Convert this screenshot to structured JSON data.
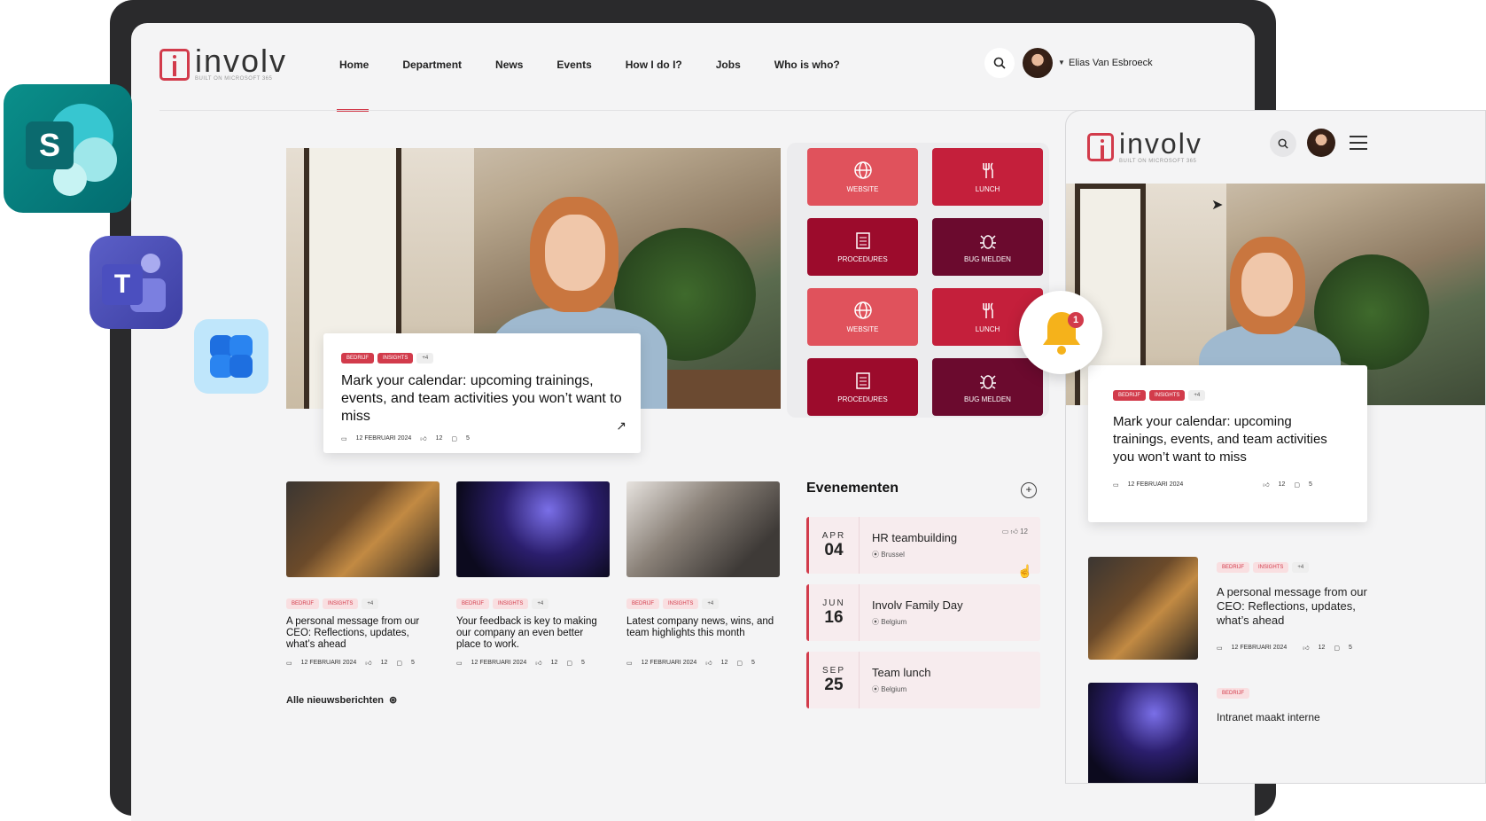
{
  "brand": {
    "name": "involv",
    "sub": "BUILT ON MICROSOFT 365",
    "accent": "#d23b4b"
  },
  "nav": {
    "items": [
      "Home",
      "Department",
      "News",
      "Events",
      "How I do I?",
      "Jobs",
      "Who is who?"
    ],
    "user": "Elias Van Esbroeck"
  },
  "hero": {
    "tags": [
      "BEDRIJF",
      "INSIGHTS",
      "+4"
    ],
    "title": "Mark your calendar: upcoming trainings, events, and team activities you won’t want to miss",
    "date": "12 FEBRUARI 2024",
    "likes": "12",
    "comments": "5"
  },
  "tiles": [
    {
      "label": "WEBSITE",
      "icon": "globe-icon"
    },
    {
      "label": "LUNCH",
      "icon": "cutlery-icon"
    },
    {
      "label": "PROCEDURES",
      "icon": "document-icon"
    },
    {
      "label": "BUG MELDEN",
      "icon": "bug-icon"
    },
    {
      "label": "WEBSITE",
      "icon": "globe-icon"
    },
    {
      "label": "LUNCH",
      "icon": "cutlery-icon"
    },
    {
      "label": "PROCEDURES",
      "icon": "document-icon"
    },
    {
      "label": "BUG MELDEN",
      "icon": "bug-icon"
    }
  ],
  "notification": {
    "count": "1"
  },
  "news": [
    {
      "tags": [
        "BEDRIJF",
        "INSIGHTS",
        "+4"
      ],
      "title": "A personal message from our CEO: Reflections, updates, what’s ahead",
      "date": "12 FEBRUARI 2024",
      "likes": "12",
      "comments": "5"
    },
    {
      "tags": [
        "BEDRIJF",
        "INSIGHTS",
        "+4"
      ],
      "title": "Your feedback is key to making our company an even better place to work.",
      "date": "12 FEBRUARI 2024",
      "likes": "12",
      "comments": "5"
    },
    {
      "tags": [
        "BEDRIJF",
        "INSIGHTS",
        "+4"
      ],
      "title": "Latest company news, wins, and team highlights this month",
      "date": "12 FEBRUARI 2024",
      "likes": "12",
      "comments": "5"
    }
  ],
  "all_news": "Alle nieuwsberichten",
  "events_title": "Evenementen",
  "events": [
    {
      "mon": "APR",
      "day": "04",
      "title": "HR teambuilding",
      "loc": "Brussel",
      "likes": "12"
    },
    {
      "mon": "JUN",
      "day": "16",
      "title": "Involv Family Day",
      "loc": "Belgium"
    },
    {
      "mon": "SEP",
      "day": "25",
      "title": "Team lunch",
      "loc": "Belgium"
    }
  ],
  "mobile": {
    "hero": {
      "tags": [
        "BEDRIJF",
        "INSIGHTS",
        "+4"
      ],
      "title": "Mark your calendar: upcoming trainings, events, and team activities you won’t want to miss",
      "date": "12 FEBRUARI 2024",
      "likes": "12",
      "comments": "5"
    },
    "news1": {
      "tags": [
        "BEDRIJF",
        "INSIGHTS",
        "+4"
      ],
      "title": "A personal message from our CEO: Reflections, updates, what’s ahead",
      "date": "12 FEBRUARI 2024",
      "likes": "12",
      "comments": "5"
    },
    "news2": {
      "tags": [
        "BEDRIJF"
      ],
      "title": "Intranet maakt interne"
    }
  },
  "apps": [
    "sharepoint-icon",
    "teams-icon",
    "viva-icon"
  ]
}
